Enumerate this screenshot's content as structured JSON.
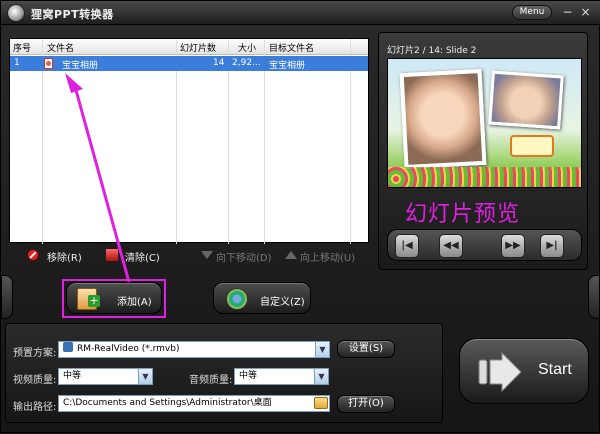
{
  "window": {
    "title": "狸窝PPT转换器",
    "menu_label": "Menu",
    "minimize": "−",
    "close": "×"
  },
  "file_list": {
    "columns": [
      "序号",
      "文件名",
      "幻灯片数",
      "大小",
      "目标文件名"
    ],
    "rows": [
      {
        "index": "1",
        "filename": "宝宝相册",
        "slides": "14",
        "size": "2,92...",
        "target": "宝宝相册"
      }
    ]
  },
  "list_toolbar": {
    "remove": "移除(R)",
    "clear": "清除(C)",
    "move_down": "向下移动(D)",
    "move_up": "向上移动(U)"
  },
  "preview": {
    "slide_label": "幻灯片2 / 14: Slide 2",
    "overlay_text": "幻灯片预览",
    "controls": [
      "first",
      "prev",
      "next",
      "last"
    ]
  },
  "actions": {
    "add": "添加(A)",
    "custom": "自定义(Z)"
  },
  "settings": {
    "preset_label": "预置方案:",
    "preset_value": "RM-RealVideo (*.rmvb)",
    "settings_button": "设置(S)",
    "video_quality_label": "视频质量:",
    "video_quality_value": "中等",
    "audio_quality_label": "音频质量:",
    "audio_quality_value": "中等",
    "output_label": "输出路径:",
    "output_path": "C:\\Documents and Settings\\Administrator\\桌面",
    "open_button": "打开(O)"
  },
  "start": {
    "label": "Start"
  },
  "colors": {
    "selection": "#3a7ddb",
    "annotation": "#e020e0"
  }
}
